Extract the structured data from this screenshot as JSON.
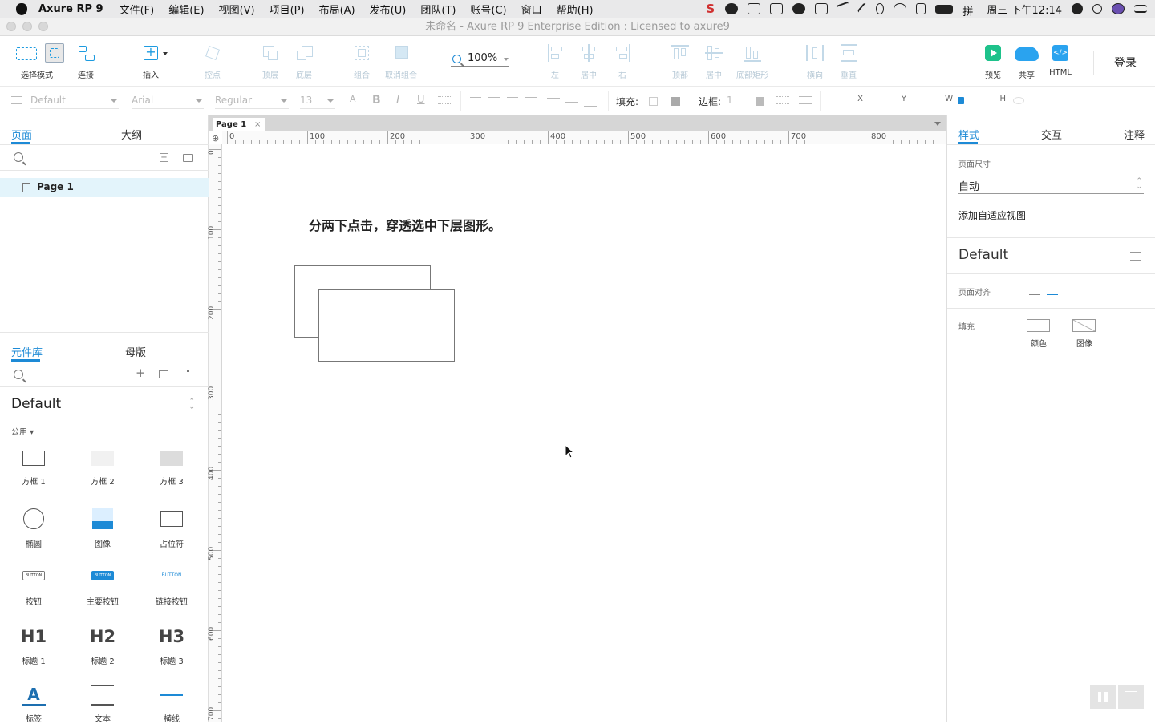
{
  "menubar": {
    "app": "Axure RP 9",
    "items": [
      "文件(F)",
      "编辑(E)",
      "视图(V)",
      "项目(P)",
      "布局(A)",
      "发布(U)",
      "团队(T)",
      "账号(C)",
      "窗口",
      "帮助(H)"
    ],
    "clock": "周三 下午12:14"
  },
  "window": {
    "title": "未命名 - Axure RP 9 Enterprise Edition : Licensed to axure9"
  },
  "toolbar": {
    "select_mode": "选择模式",
    "connect": "连接",
    "insert": "插入",
    "point": "控点",
    "top_layer": "顶层",
    "bottom_layer": "底层",
    "group": "组合",
    "ungroup": "取消组合",
    "zoom": "100%",
    "align_left": "左",
    "align_center": "居中",
    "align_right": "右",
    "align_top": "顶部",
    "align_middle": "居中",
    "align_bottom": "底部矩形",
    "distribute_h": "横向",
    "distribute_v": "垂直",
    "preview": "预览",
    "share": "共享",
    "html": "HTML",
    "login": "登录"
  },
  "format": {
    "style": "Default",
    "font": "Arial",
    "weight": "Regular",
    "size": "13",
    "fill_label": "填充:",
    "border_label": "边框:",
    "border_value": "1",
    "x_label": "X",
    "y_label": "Y",
    "w_label": "W",
    "h_label": "H"
  },
  "left": {
    "tabs": [
      "页面",
      "大纲"
    ],
    "page": "Page 1",
    "lib_tabs": [
      "元件库",
      "母版"
    ],
    "library": "Default",
    "category": "公用 ▾",
    "widgets": [
      "方框 1",
      "方框 2",
      "方框 3",
      "椭圆",
      "图像",
      "占位符",
      "按钮",
      "主要按钮",
      "链接按钮",
      "标题 1",
      "标题 2",
      "标题 3",
      "标签",
      "文本",
      "横线"
    ],
    "button_text": "BUTTON",
    "h1": "H1",
    "h2": "H2",
    "h3": "H3"
  },
  "canvas": {
    "tab": "Page 1",
    "instruction": "分两下点击，穿透选中下层图形。",
    "hruler": [
      "0",
      "100",
      "200",
      "300",
      "400",
      "500",
      "600",
      "700",
      "800"
    ],
    "vruler": [
      "0",
      "100",
      "200",
      "300",
      "400",
      "500",
      "600",
      "700"
    ]
  },
  "right": {
    "tabs": [
      "样式",
      "交互",
      "注释"
    ],
    "page_size_label": "页面尺寸",
    "page_size": "自动",
    "adaptive_link": "添加自适应视图",
    "style_name": "Default",
    "align_label": "页面对齐",
    "fill_label": "填充",
    "fill_color": "颜色",
    "fill_image": "图像"
  }
}
